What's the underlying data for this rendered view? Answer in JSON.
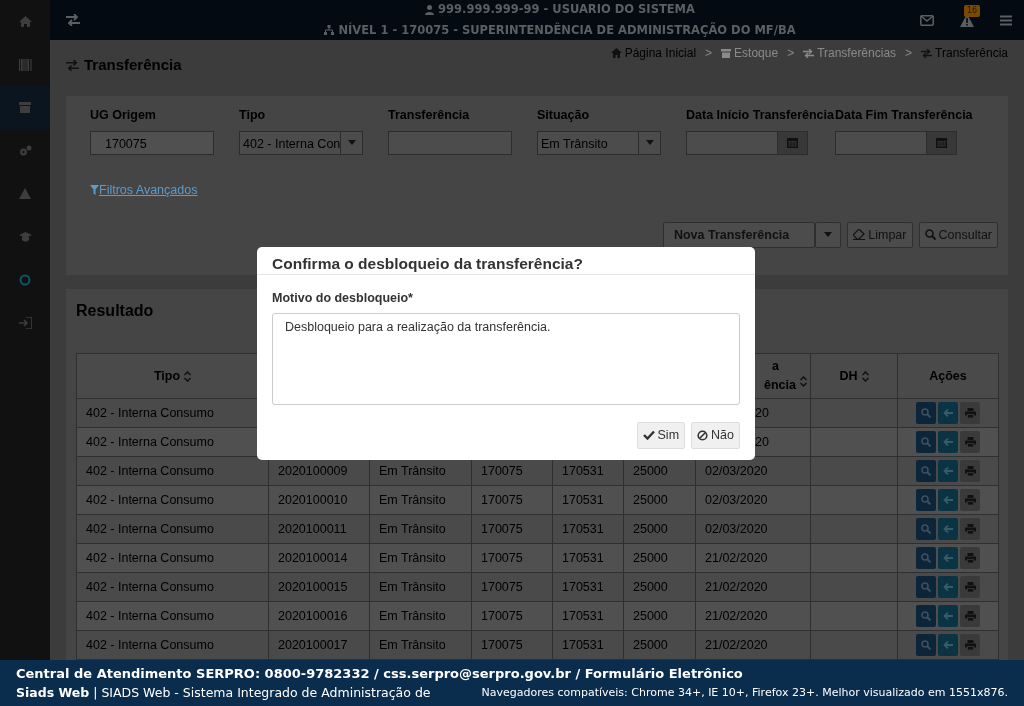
{
  "sidebar": {
    "items": [
      {
        "selected": false
      },
      {
        "selected": false
      },
      {
        "selected": true
      },
      {
        "selected": false
      },
      {
        "selected": false
      },
      {
        "selected": false
      },
      {
        "selected": false
      },
      {
        "selected": false
      }
    ]
  },
  "topbar": {
    "user": "999.999.999-99 - USUARIO DO SISTEMA",
    "unit": "NÍVEL 1 - 170075 - SUPERINTENDÊNCIA DE ADMINISTRAÇÃO DO MF/BA",
    "alerts_badge": "16"
  },
  "page_title": "Transferência",
  "breadcrumb": {
    "separator": ">",
    "items": [
      {
        "label": "Página Inicial",
        "disabled": false
      },
      {
        "label": "Estoque",
        "disabled": true
      },
      {
        "label": "Transferências",
        "disabled": true
      },
      {
        "label": "Transferência",
        "disabled": false
      }
    ]
  },
  "filters": [
    {
      "label": "UG Origem",
      "kind": "readonly",
      "value": "170075"
    },
    {
      "label": "Tipo",
      "kind": "select",
      "value": "402 - Interna Con"
    },
    {
      "label": "Transferência",
      "kind": "text"
    },
    {
      "label": "Situação",
      "kind": "select",
      "value": "Em Trânsito"
    },
    {
      "label": "Data Início Transferência",
      "kind": "date"
    },
    {
      "label": "Data Fim Transferência",
      "kind": "date"
    }
  ],
  "advanced_filters": "Filtros Avançados",
  "actions": {
    "new": "Nova Transferência",
    "clear": "Limpar",
    "search": "Consultar"
  },
  "result": {
    "title": "Resultado",
    "header": {
      "tipo": "Tipo",
      "date_lines": [
        "a",
        "ência"
      ],
      "dh": "DH",
      "actions": "Ações"
    },
    "rows": [
      {
        "cells": [
          "402 - Interna Consumo"
        ],
        "date_fragment": "20"
      },
      {
        "cells": [
          "402 - Interna Consumo"
        ],
        "date_fragment": "20"
      },
      {
        "cells": [
          "402 - Interna Consumo",
          "2020100009",
          "Em Trânsito",
          "170075",
          "170531",
          "25000",
          "02/03/2020"
        ]
      },
      {
        "cells": [
          "402 - Interna Consumo",
          "2020100010",
          "Em Trânsito",
          "170075",
          "170531",
          "25000",
          "02/03/2020"
        ]
      },
      {
        "cells": [
          "402 - Interna Consumo",
          "2020100011",
          "Em Trânsito",
          "170075",
          "170531",
          "25000",
          "02/03/2020"
        ]
      },
      {
        "cells": [
          "402 - Interna Consumo",
          "2020100014",
          "Em Trânsito",
          "170075",
          "170531",
          "25000",
          "21/02/2020"
        ]
      },
      {
        "cells": [
          "402 - Interna Consumo",
          "2020100015",
          "Em Trânsito",
          "170075",
          "170531",
          "25000",
          "21/02/2020"
        ]
      },
      {
        "cells": [
          "402 - Interna Consumo",
          "2020100016",
          "Em Trânsito",
          "170075",
          "170531",
          "25000",
          "21/02/2020"
        ]
      },
      {
        "cells": [
          "402 - Interna Consumo",
          "2020100017",
          "Em Trânsito",
          "170075",
          "170531",
          "25000",
          "21/02/2020"
        ]
      }
    ]
  },
  "modal": {
    "title": "Confirma o desbloqueio da transferência?",
    "label": "Motivo do desbloqueio*",
    "value": "Desbloqueio para a realização da transferência.",
    "yes": "Sim",
    "no": "Não"
  },
  "footer": {
    "contact": "Central de Atendimento SERPRO: 0800-9782332 / css.serpro@serpro.gov.br / Formulário Eletrônico",
    "system": "**Siads Web** | SIADS Web - Sistema Integrado de Administração de",
    "browsers": "Navegadores compatíveis: Chrome 34+, IE 10+, Firefox 23+. Melhor visualizado em 1551x876."
  }
}
